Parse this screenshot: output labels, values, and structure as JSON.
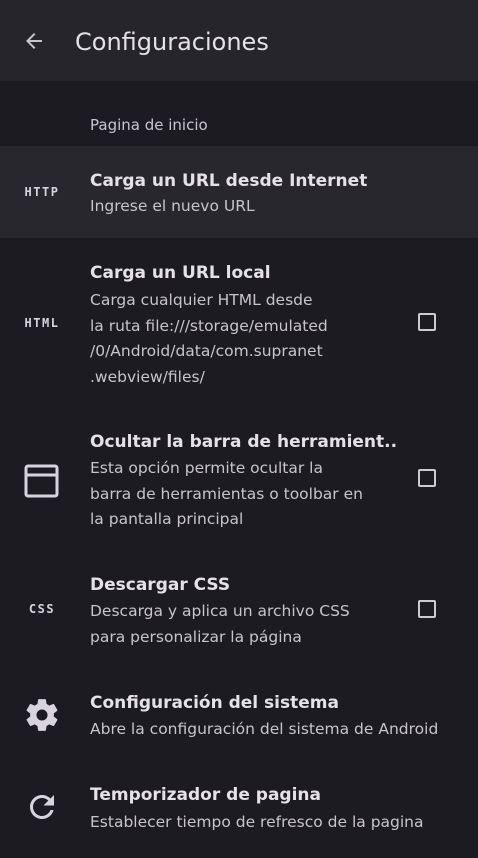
{
  "appbar": {
    "title": "Configuraciones",
    "back_icon": "arrow-back-icon"
  },
  "section": {
    "title": "Pagina de inicio"
  },
  "items": [
    {
      "icon_text": "HTTP",
      "title": "Carga un URL desde Internet",
      "subtitle": "Ingrese el nuevo URL",
      "has_checkbox": false
    },
    {
      "icon_text": "HTML",
      "title": "Carga un URL local",
      "subtitle": "Carga cualquier HTML desde\nla ruta file:///storage/emulated\n/0/Android/data/com.supranet\n.webview/files/",
      "has_checkbox": true,
      "checked": false
    },
    {
      "icon": "window-frame-icon",
      "title": "Ocultar la barra de herramient..",
      "subtitle": "Esta opción permite ocultar la\nbarra de herramientas o toolbar en\nla pantalla principal",
      "has_checkbox": true,
      "checked": false
    },
    {
      "icon_text": "CSS",
      "title": "Descargar CSS",
      "subtitle": "Descarga y aplica un archivo CSS\npara personalizar la página",
      "has_checkbox": true,
      "checked": false
    },
    {
      "icon": "gear-icon",
      "title": "Configuración del sistema",
      "subtitle": "Abre la configuración del sistema de Android",
      "has_checkbox": false
    },
    {
      "icon": "refresh-icon",
      "title": "Temporizador de pagina",
      "subtitle": "Establecer tiempo de refresco de la pagina",
      "has_checkbox": false
    }
  ]
}
